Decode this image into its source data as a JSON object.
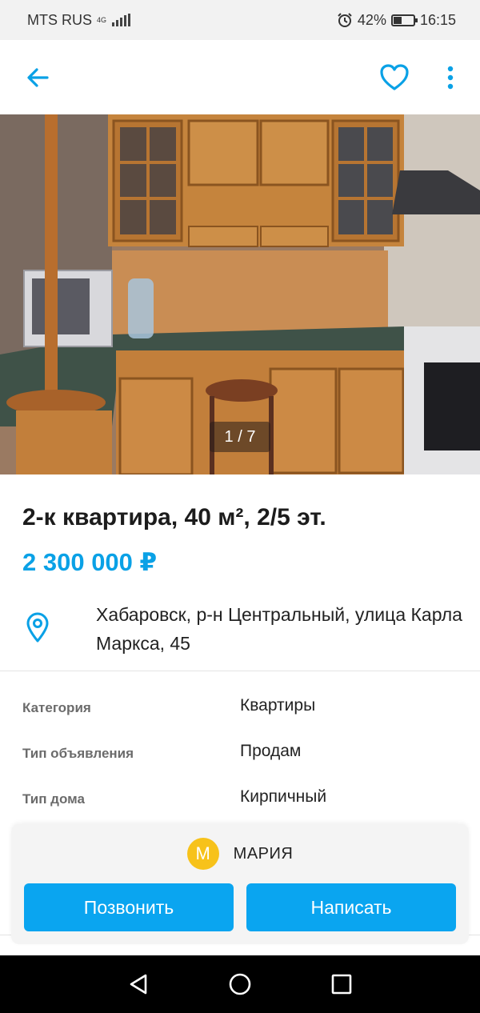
{
  "status_bar": {
    "carrier": "MTS RUS",
    "network": "4G",
    "battery_percent": "42%",
    "battery_level": 0.42,
    "time": "16:15"
  },
  "header": {
    "back_icon": "arrow-left-icon",
    "favorite_icon": "heart-outline-icon",
    "menu_icon": "more-vertical-icon",
    "accent_color": "#0aa1e6"
  },
  "gallery": {
    "counter": "1 / 7",
    "current": 1,
    "total": 7
  },
  "listing": {
    "title": "2-к квартира, 40 м², 2/5 эт.",
    "price": "2 300 000 ₽",
    "address": "Хабаровск, р-н Центральный, улица Карла Маркса, 45",
    "location_icon": "map-pin-icon"
  },
  "params": [
    {
      "key": "Категория",
      "value": "Квартиры"
    },
    {
      "key": "Тип объявления",
      "value": "Продам"
    },
    {
      "key": "Тип дома",
      "value": "Кирпичный"
    }
  ],
  "contact": {
    "avatar_letter": "М",
    "avatar_color": "#f7c21a",
    "seller_name": "МАРИЯ",
    "call_label": "Позвонить",
    "message_label": "Написать",
    "button_color": "#0aa5f0"
  }
}
